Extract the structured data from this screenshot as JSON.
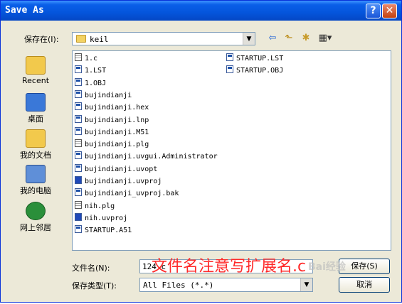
{
  "window": {
    "title": "Save As"
  },
  "toolbar": {
    "save_in_label": "保存在(I):",
    "save_in_value": "keil"
  },
  "places": [
    {
      "label": "Recent",
      "color": "#f2c94c"
    },
    {
      "label": "桌面",
      "color": "#3a78d8"
    },
    {
      "label": "我的文档",
      "color": "#f2c94c"
    },
    {
      "label": "我的电脑",
      "color": "#5f8fd8"
    },
    {
      "label": "网上邻居",
      "color": "#2a8f3a"
    }
  ],
  "files_col1": [
    {
      "name": "1.c",
      "icon": "doc"
    },
    {
      "name": "1.LST",
      "icon": "app"
    },
    {
      "name": "1.OBJ",
      "icon": "app"
    },
    {
      "name": "bujindianji",
      "icon": "app"
    },
    {
      "name": "bujindianji.hex",
      "icon": "app"
    },
    {
      "name": "bujindianji.lnp",
      "icon": "app"
    },
    {
      "name": "bujindianji.M51",
      "icon": "app"
    },
    {
      "name": "bujindianji.plg",
      "icon": "doc"
    },
    {
      "name": "bujindianji.uvgui.Administrator",
      "icon": "app"
    },
    {
      "name": "bujindianji.uvopt",
      "icon": "app"
    },
    {
      "name": "bujindianji.uvproj",
      "icon": "proj"
    },
    {
      "name": "bujindianji_uvproj.bak",
      "icon": "app"
    },
    {
      "name": "nih.plg",
      "icon": "doc"
    },
    {
      "name": "nih.uvproj",
      "icon": "proj"
    },
    {
      "name": "STARTUP.A51",
      "icon": "app"
    }
  ],
  "files_col2": [
    {
      "name": "STARTUP.LST",
      "icon": "app"
    },
    {
      "name": "STARTUP.OBJ",
      "icon": "app"
    }
  ],
  "bottom": {
    "file_name_label": "文件名(N):",
    "file_name_value": "124.c",
    "file_type_label": "保存类型(T):",
    "file_type_value": "All Files (*.*)",
    "save_button": "保存(S)",
    "cancel_button": "取消"
  },
  "annotation": "文件名注意写扩展名.c",
  "watermark": "Bai经验"
}
